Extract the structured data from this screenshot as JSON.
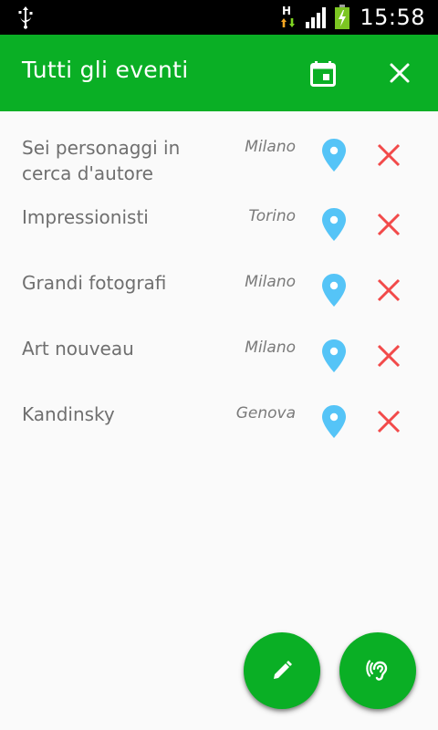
{
  "status_bar": {
    "time": "15:58",
    "network_label": "H",
    "icons": [
      "usb-icon",
      "network-h-icon",
      "signal-icon",
      "battery-charging-icon"
    ]
  },
  "app_bar": {
    "title": "Tutti gli eventi",
    "calendar_icon": "calendar-icon",
    "close_icon": "close-icon"
  },
  "events": [
    {
      "title": "Sei personaggi in cerca d'autore",
      "city": "Milano"
    },
    {
      "title": "Impressionisti",
      "city": "Torino"
    },
    {
      "title": "Grandi fotografi",
      "city": "Milano"
    },
    {
      "title": "Art nouveau",
      "city": "Milano"
    },
    {
      "title": "Kandinsky",
      "city": "Genova"
    }
  ],
  "row_icons": {
    "location": "map-pin-icon",
    "delete": "delete-x-icon"
  },
  "fabs": {
    "edit_icon": "pencil-icon",
    "listen_icon": "hearing-icon"
  },
  "colors": {
    "primary": "#0aaf25",
    "pin": "#55c4f7",
    "delete": "#f24a4a",
    "text": "#6f6f6f",
    "background": "#fafafa"
  }
}
